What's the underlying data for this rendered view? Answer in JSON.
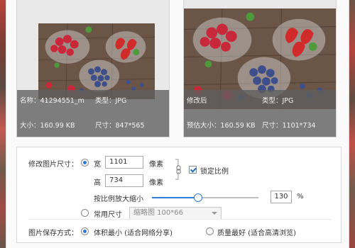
{
  "original": {
    "name_label": "名称：41294551_m",
    "type_label": "类型：JPG",
    "size_label": "大小：160.99 KB",
    "dims_label": "尺寸：847*565"
  },
  "modified": {
    "title_label": "修改后",
    "type_label": "类型：JPG",
    "size_label": "预估大小：160.59 KB",
    "dims_label": "尺寸：1101*734"
  },
  "resize": {
    "section_label": "修改图片尺寸：",
    "width_label": "宽",
    "width_value": "1101",
    "width_unit": "像素",
    "height_label": "高",
    "height_value": "734",
    "height_unit": "像素",
    "lock_ratio_label": "锁定比例",
    "lock_ratio_checked": true,
    "scale_label": "按比例放大缩小",
    "scale_value": "130",
    "scale_unit": "%",
    "scale_fraction": 0.43,
    "common_size_label": "常用尺寸",
    "common_size_value": "缩略图 100*66"
  },
  "save_mode": {
    "label": "图片保存方式：",
    "option_small": "体积最小 (适合网络分享)",
    "option_quality": "质量最好 (适合高清浏览)"
  },
  "colors": {
    "accent": "#2d7bd6",
    "info_overlay": "#5f5f5f"
  }
}
